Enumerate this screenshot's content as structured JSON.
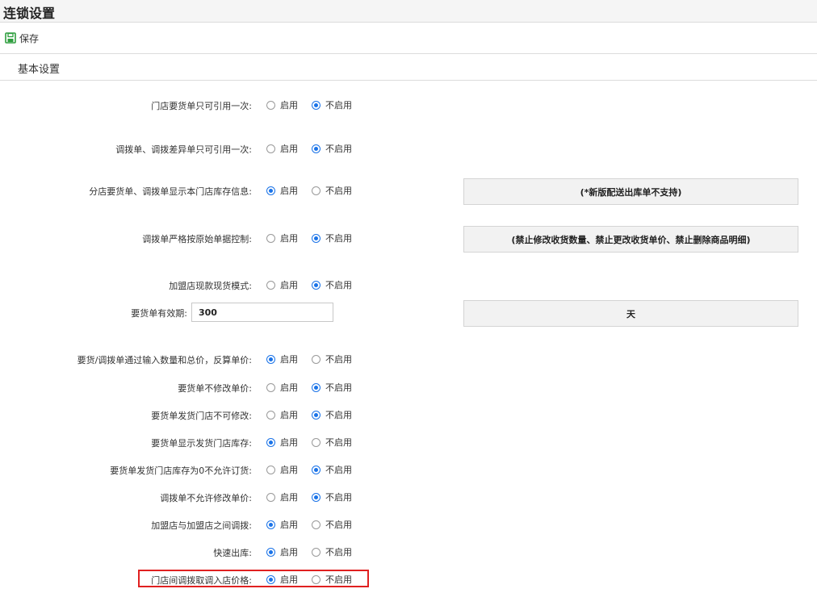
{
  "page_title": "连锁设置",
  "toolbar": {
    "save_label": "保存",
    "save_icon": "save-icon"
  },
  "section_title": "基本设置",
  "options": {
    "enable": "启用",
    "disable": "不启用"
  },
  "settings": [
    {
      "label": "门店要货单只可引用一次:",
      "enabled": false
    },
    {
      "label": "调拨单、调拨差异单只可引用一次:",
      "enabled": false
    },
    {
      "label": "分店要货单、调拨单显示本门店库存信息:",
      "enabled": true
    },
    {
      "label": "调拨单严格按原始单据控制:",
      "enabled": false
    },
    {
      "label": "加盟店现款现货模式:",
      "enabled": false
    },
    {
      "label": "要货/调拨单通过输入数量和总价，反算单价:",
      "enabled": true
    },
    {
      "label": "要货单不修改单价:",
      "enabled": false
    },
    {
      "label": "要货单发货门店不可修改:",
      "enabled": false
    },
    {
      "label": "要货单显示发货门店库存:",
      "enabled": true
    },
    {
      "label": "要货单发货门店库存为0不允许订货:",
      "enabled": false
    },
    {
      "label": "调拨单不允许修改单价:",
      "enabled": false
    },
    {
      "label": "加盟店与加盟店之间调拨:",
      "enabled": true
    },
    {
      "label": "快速出库:",
      "enabled": true
    },
    {
      "label": "门店间调拨取调入店价格:",
      "enabled": true
    }
  ],
  "validity": {
    "label": "要货单有效期:",
    "value": "300",
    "unit": "天"
  },
  "notes": {
    "branch_stock": "(*新版配送出库单不支持)",
    "strict_control": "(禁止修改收货数量、禁止更改收货单价、禁止删除商品明细)"
  },
  "colors": {
    "accent": "#1a73e8",
    "highlight": "#e02020",
    "save_icon": "#2e9e3e"
  }
}
